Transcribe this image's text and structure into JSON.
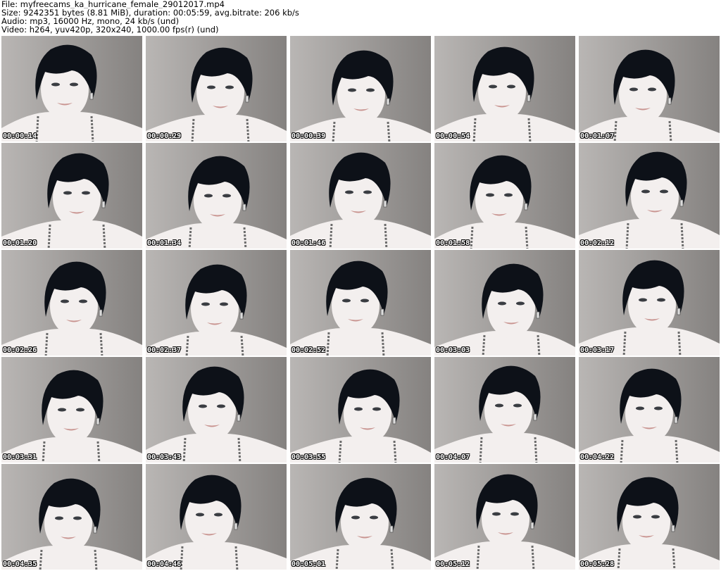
{
  "header": {
    "file_line": "File: myfreecams_ka_hurricane_female_29012017.mp4",
    "size_line": "Size: 9242351 bytes (8.81 MiB), duration: 00:05:59, avg.bitrate: 206 kb/s",
    "audio_line": "Audio: mp3, 16000 Hz, mono, 24 kb/s (und)",
    "video_line": "Video: h264, yuv420p, 320x240, 1000.00 fps(r) (und)"
  },
  "colors": {
    "background": "#ffffff",
    "wall": "#9d9a98",
    "hair": "#0d1118",
    "skin": "#f3efee",
    "lips": "#c99591",
    "timestamp_text": "#ffffff",
    "timestamp_outline": "#000000"
  },
  "thumbnails": [
    {
      "timestamp": "00:00:14"
    },
    {
      "timestamp": "00:00:29"
    },
    {
      "timestamp": "00:00:39"
    },
    {
      "timestamp": "00:00:54"
    },
    {
      "timestamp": "00:01:07"
    },
    {
      "timestamp": "00:01:20"
    },
    {
      "timestamp": "00:01:34"
    },
    {
      "timestamp": "00:01:46"
    },
    {
      "timestamp": "00:01:58"
    },
    {
      "timestamp": "00:02:12"
    },
    {
      "timestamp": "00:02:26"
    },
    {
      "timestamp": "00:02:37"
    },
    {
      "timestamp": "00:02:52"
    },
    {
      "timestamp": "00:03:03"
    },
    {
      "timestamp": "00:03:17"
    },
    {
      "timestamp": "00:03:31"
    },
    {
      "timestamp": "00:03:43"
    },
    {
      "timestamp": "00:03:55"
    },
    {
      "timestamp": "00:04:07"
    },
    {
      "timestamp": "00:04:22"
    },
    {
      "timestamp": "00:04:35"
    },
    {
      "timestamp": "00:04:46"
    },
    {
      "timestamp": "00:05:01"
    },
    {
      "timestamp": "00:05:12"
    },
    {
      "timestamp": "00:05:28"
    }
  ]
}
